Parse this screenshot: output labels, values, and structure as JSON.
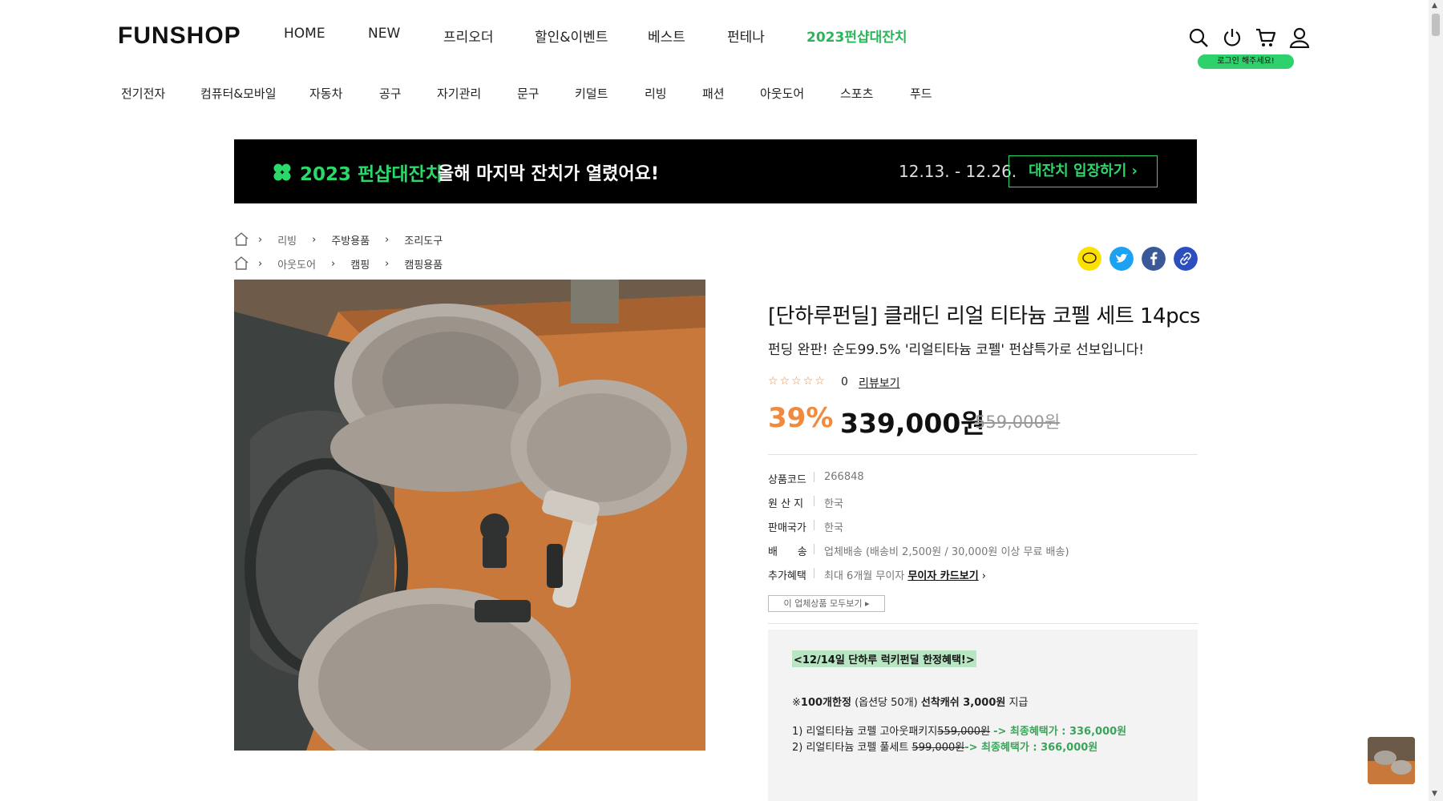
{
  "logo": "FUNSHOP",
  "gnb": [
    {
      "label": "HOME"
    },
    {
      "label": "NEW"
    },
    {
      "label": "프리오더"
    },
    {
      "label": "할인&이벤트"
    },
    {
      "label": "베스트"
    },
    {
      "label": "펀테나"
    },
    {
      "label": "2023펀샵대잔치"
    }
  ],
  "login_tip": "로그인 해주세요!",
  "categories": [
    "전기전자",
    "컴퓨터&모바일",
    "자동차",
    "공구",
    "자기관리",
    "문구",
    "키덜트",
    "리빙",
    "패션",
    "아웃도어",
    "스포츠",
    "푸드"
  ],
  "banner": {
    "title": "2023 펀샵대잔치",
    "subtitle": "올해 마지막 잔치가 열렸어요!",
    "date": "12.13. - 12.26.",
    "button": "대잔치 입장하기 ›"
  },
  "breadcrumbs": [
    [
      "리빙",
      "주방용품",
      "조리도구"
    ],
    [
      "아웃도어",
      "캠핑",
      "캠핑용품"
    ]
  ],
  "product": {
    "title": "[단하루펀딜] 클래딘 리얼 티타늄 코펠 세트 14pcs",
    "subtitle": "펀딩 완판! 순도99.5% '리얼티타늄 코펠' 펀샵특가로 선보입니다!",
    "stars": "☆☆☆☆☆",
    "review_count": "0",
    "review_link": "리뷰보기",
    "discount": "39%",
    "price": "339,000원",
    "original_price": "559,000원"
  },
  "specs": [
    {
      "label": "상품코드",
      "value": "266848"
    },
    {
      "label": "원 산 지",
      "value": "한국"
    },
    {
      "label": "판매국가",
      "value": "한국"
    },
    {
      "label": "배      송",
      "value": "업체배송 (배송비 2,500원 / 30,000원 이상 무료 배송)"
    },
    {
      "label": "추가혜택",
      "value": "최대 6개월 무이자",
      "link": "무이자 카드보기"
    }
  ],
  "seller_button": "이 업체상품 모두보기 ▸",
  "benefit": {
    "tag": "<12/14일 단하루 럭키펀딜 한정혜택!>",
    "line_prefix": "※",
    "line_b1": "100개한정",
    "line_mid": " (옵션당 50개) ",
    "line_b2": "선착캐쉬 3,000원",
    "line_end": " 지급",
    "item1_text": "1) 리얼티타늄 코펠 고아웃패키지",
    "item1_strike": "559,000원",
    "item1_arrow": "-> 최종혜택가 : 336,000원",
    "item2_text": "2) 리얼티타늄 코펠 풀세트",
    "item2_strike": "599,000원",
    "item2_arrow": "-> 최종혜택가 : 366,000원"
  },
  "colors": {
    "accent": "#2bd96a",
    "discount": "#f08a3c",
    "banner_bg": "#000000"
  }
}
